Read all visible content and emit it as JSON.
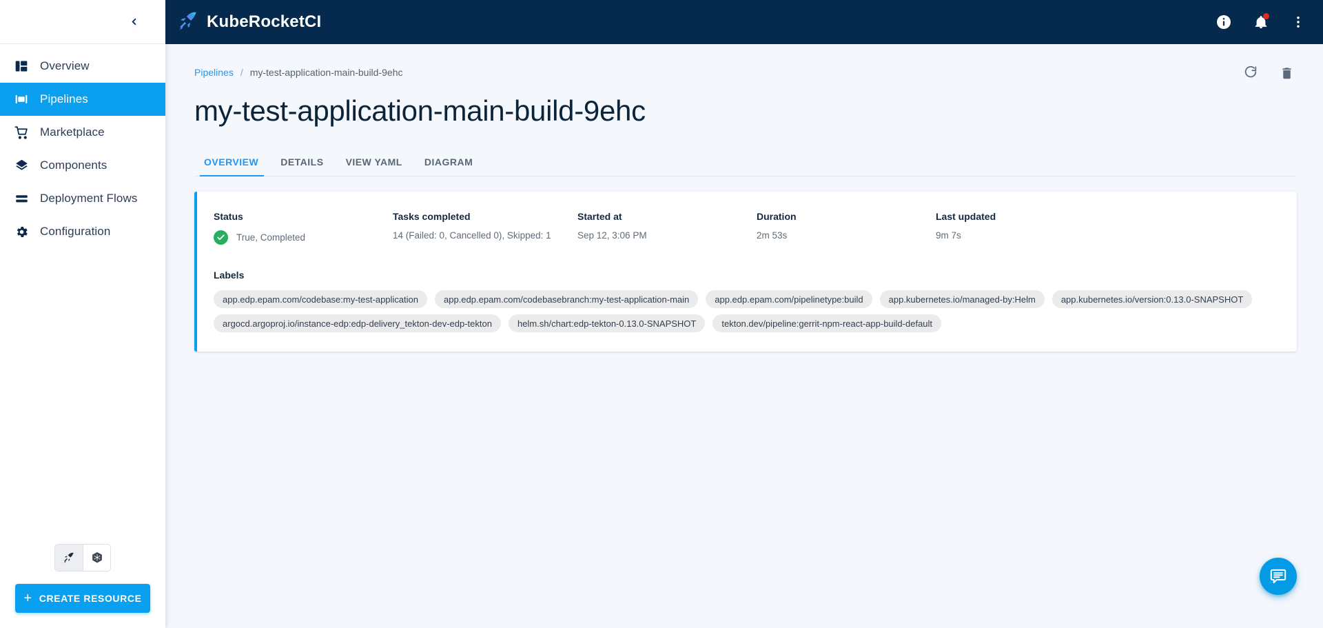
{
  "app": {
    "brand_name": "KubeRocketCI",
    "logo_icon": "rocket-logo-icon"
  },
  "topbar": {
    "info_icon": "info-circle-icon",
    "notifications_icon": "bell-icon",
    "has_notification": true,
    "more_icon": "kebab-menu-icon"
  },
  "sidebar": {
    "collapse_icon": "chevron-left-icon",
    "items": [
      {
        "label": "Overview",
        "icon": "dashboard-icon",
        "active": false
      },
      {
        "label": "Pipelines",
        "icon": "pipelines-icon",
        "active": true
      },
      {
        "label": "Marketplace",
        "icon": "cart-icon",
        "active": false
      },
      {
        "label": "Components",
        "icon": "layers-icon",
        "active": false
      },
      {
        "label": "Deployment Flows",
        "icon": "stack-lines-icon",
        "active": false
      },
      {
        "label": "Configuration",
        "icon": "gear-icon",
        "active": false
      }
    ],
    "mode_toggle": [
      {
        "icon": "rocket-icon",
        "selected": true
      },
      {
        "icon": "kubernetes-icon",
        "selected": false
      }
    ],
    "create_button": {
      "label": "CREATE RESOURCE",
      "plus": "+"
    }
  },
  "breadcrumb": {
    "parent": "Pipelines",
    "separator": "/",
    "current": "my-test-application-main-build-9ehc"
  },
  "page_actions": {
    "refresh_icon": "refresh-icon",
    "delete_icon": "trash-icon"
  },
  "page": {
    "title": "my-test-application-main-build-9ehc"
  },
  "tabs": [
    {
      "label": "OVERVIEW",
      "active": true
    },
    {
      "label": "DETAILS",
      "active": false
    },
    {
      "label": "VIEW YAML",
      "active": false
    },
    {
      "label": "DIAGRAM",
      "active": false
    }
  ],
  "card": {
    "accent_color": "#0aa0ef",
    "fields": [
      {
        "label": "Status",
        "value": "True, Completed",
        "icon": "check-circle-icon",
        "icon_color": "#27ae60"
      },
      {
        "label": "Tasks completed",
        "value": "14 (Failed: 0, Cancelled 0), Skipped: 1"
      },
      {
        "label": "Started at",
        "value": "Sep 12, 3:06 PM"
      },
      {
        "label": "Duration",
        "value": "2m 53s"
      },
      {
        "label": "Last updated",
        "value": "9m 7s"
      }
    ],
    "labels_title": "Labels",
    "labels": [
      "app.edp.epam.com/codebase:my-test-application",
      "app.edp.epam.com/codebasebranch:my-test-application-main",
      "app.edp.epam.com/pipelinetype:build",
      "app.kubernetes.io/managed-by:Helm",
      "app.kubernetes.io/version:0.13.0-SNAPSHOT",
      "argocd.argoproj.io/instance-edp:edp-delivery_tekton-dev-edp-tekton",
      "helm.sh/chart:edp-tekton-0.13.0-SNAPSHOT",
      "tekton.dev/pipeline:gerrit-npm-react-app-build-default"
    ]
  },
  "fab": {
    "icon": "chat-bubble-icon",
    "color": "#039be5"
  }
}
